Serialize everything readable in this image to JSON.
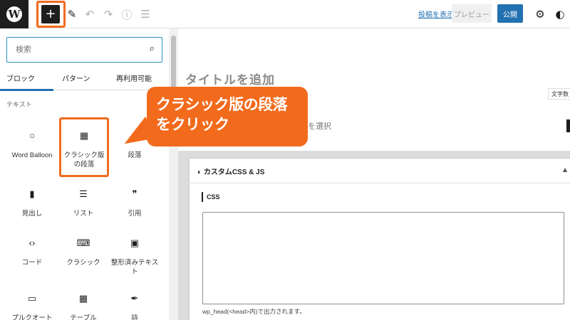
{
  "toolbar": {
    "logo": "W",
    "inserter_symbol": "+",
    "view_post": "投稿を表示",
    "preview": "プレビュー",
    "publish": "公開"
  },
  "icons": {
    "pen": "✎",
    "undo": "↶",
    "redo": "↷",
    "info": "ⓘ",
    "outline": "☰",
    "gear": "⚙",
    "jetpack": "◐",
    "search": "⌕"
  },
  "search": {
    "placeholder": "検索"
  },
  "tabs": [
    "ブロック",
    "パターン",
    "再利用可能"
  ],
  "category": "テキスト",
  "blocks": [
    {
      "icon": "○",
      "label": "Word Balloon"
    },
    {
      "icon": "▦",
      "label": "クラシック版の段落"
    },
    {
      "icon": "¶",
      "label": "段落"
    },
    {
      "icon": "▮",
      "label": "見出し"
    },
    {
      "icon": "☰",
      "label": "リスト"
    },
    {
      "icon": "❞",
      "label": "引用"
    },
    {
      "icon": "‹›",
      "label": "コード"
    },
    {
      "icon": "⌨",
      "label": "クラシック"
    },
    {
      "icon": "▣",
      "label": "整形済みテキスト"
    },
    {
      "icon": "▭",
      "label": "プルクオート"
    },
    {
      "icon": "▦",
      "label": "テーブル"
    },
    {
      "icon": "✒",
      "label": "詩"
    }
  ],
  "callout": {
    "line1": "クラシック版の段落",
    "line2": "をクリック"
  },
  "editor": {
    "title_placeholder": "タイトルを追加",
    "word_count": "文字数",
    "block_hint": "を選択"
  },
  "metabox": {
    "title": "カスタムCSS & JS",
    "css_label": "CSS",
    "note": "wp_head(<head>内)で出力されます。"
  },
  "colors": {
    "accent": "#f26b1d",
    "primary": "#2271b1"
  }
}
